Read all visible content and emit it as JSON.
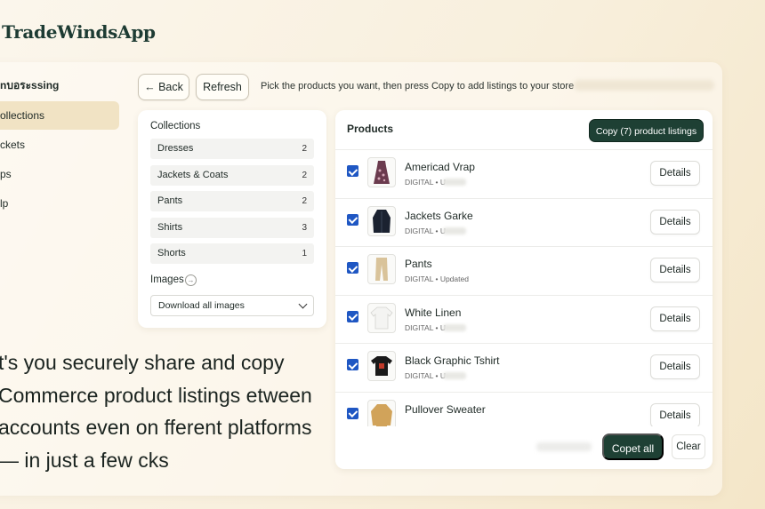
{
  "app": {
    "brand": "TradeWindsApp"
  },
  "sidebar": {
    "title": "nบอระssing",
    "items": [
      {
        "label": "ollections",
        "active": true
      },
      {
        "label": "ckets",
        "active": false
      },
      {
        "label": "ps",
        "active": false
      },
      {
        "label": "lp",
        "active": false
      }
    ]
  },
  "toolbar": {
    "back_label": "← Back",
    "refresh_label": "Refresh",
    "hint": "Pick the products you want, then press Copy to add listings to your store"
  },
  "collections": {
    "title": "Collections",
    "rows": [
      {
        "name": "Dresses",
        "count": "2"
      },
      {
        "name": "Jackets & Coats",
        "count": "2"
      },
      {
        "name": "Pants",
        "count": "2"
      },
      {
        "name": "Shirts",
        "count": "3"
      },
      {
        "name": "Shorts",
        "count": "1"
      }
    ],
    "images_label": "Images",
    "images_select": "Download all images"
  },
  "products": {
    "title": "Products",
    "copy_button": "Copy (7) product listings",
    "details_label": "Details",
    "items": [
      {
        "name": "Americad Vrap",
        "meta": "DIGITAL • U",
        "icon": "dress-icon",
        "color": "#6b3b4e",
        "checked": true
      },
      {
        "name": "Jackets Garke",
        "meta": "DIGITAL • U",
        "icon": "jacket-icon",
        "color": "#1b2230",
        "checked": true
      },
      {
        "name": "Pants",
        "meta": "DIGITAL • Updated",
        "icon": "pants-icon",
        "color": "#d9c39a",
        "checked": true
      },
      {
        "name": "White Linen",
        "meta": "DIGITAL • U",
        "icon": "shirt-icon",
        "color": "#f4f4f2",
        "checked": true
      },
      {
        "name": "Black Graphic Tshirt",
        "meta": "DIGITAL • U",
        "icon": "tshirt-icon",
        "color": "#1a1a1a",
        "checked": true
      },
      {
        "name": "Pullover Sweater",
        "meta": "",
        "icon": "sweater-icon",
        "color": "#d1a35a",
        "checked": true
      }
    ],
    "copy_all": "Copet all",
    "clear": "Clear"
  },
  "tagline": "t's you securely share and copy Commerce product listings etween accounts even on fferent platforms — in just a few cks"
}
